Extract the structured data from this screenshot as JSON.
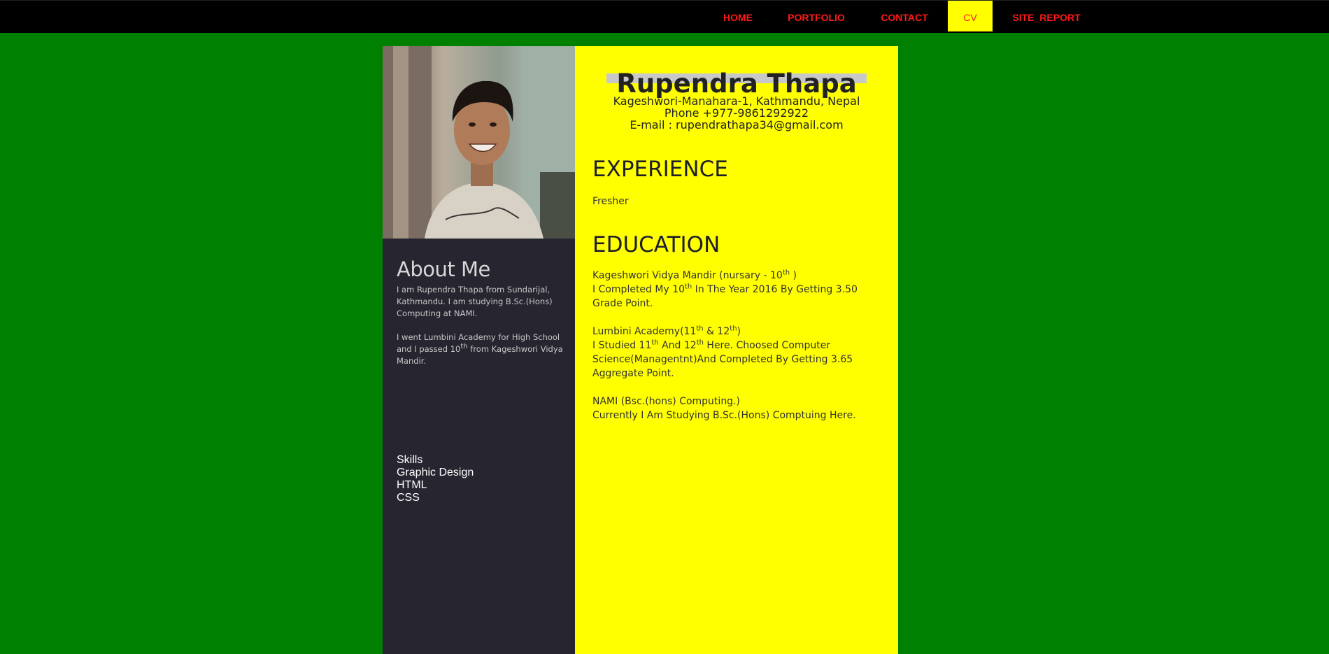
{
  "nav": {
    "items": [
      {
        "label": "HOME"
      },
      {
        "label": "PORTFOLIO"
      },
      {
        "label": "CONTACT"
      },
      {
        "label": "CV"
      },
      {
        "label": "SITE_REPORT"
      }
    ],
    "active": "CV"
  },
  "sidebar": {
    "about_heading": "About Me",
    "about_p1": "I am Rupendra Thapa from Sundarijal, Kathmandu. I am studying B.Sc.(Hons) Computing at NAMI.",
    "about_p2_before": "I went Lumbini Academy for High School and I passed 10",
    "about_p2_sup": "th",
    "about_p2_after": " from Kageshwori Vidya Mandir.",
    "skills": [
      "Skills",
      "Graphic Design",
      "HTML",
      "CSS"
    ]
  },
  "main": {
    "name": "Rupendra Thapa",
    "address": "Kageshwori-Manahara-1, Kathmandu, Nepal",
    "phone": "Phone +977-9861292922",
    "email": "E-mail : rupendrathapa34@gmail.com",
    "experience_title": "EXPERIENCE",
    "experience_text": "Fresher",
    "education_title": "EDUCATION",
    "edu1_title_a": "Kageshwori Vidya Mandir (nursary - 10",
    "edu1_title_sup": "th",
    "edu1_title_b": " )",
    "edu1_text_a": "I Completed My 10",
    "edu1_text_sup": "th",
    "edu1_text_b": " In The Year 2016 By Getting 3.50 Grade Point.",
    "edu2_title_a": "Lumbini Academy(11",
    "edu2_title_sup1": "th",
    "edu2_title_b": " & 12",
    "edu2_title_sup2": "th",
    "edu2_title_c": ")",
    "edu2_text_a": "I Studied 11",
    "edu2_text_sup1": "th",
    "edu2_text_b": " And 12",
    "edu2_text_sup2": "th",
    "edu2_text_c": " Here. Choosed Computer Science(Managentnt)And Completed By Getting 3.65 Aggregate Point.",
    "edu3_title": "NAMI (Bsc.(hons) Computing.)",
    "edu3_text": "Currently I Am Studying B.Sc.(Hons) Comptuing Here."
  },
  "colors": {
    "background": "#008000",
    "nav_bg": "#000000",
    "nav_text": "#ff1a1a",
    "active_bg": "#ffff00",
    "main_bg": "#ffff00",
    "sidebar_bg": "#262530"
  }
}
